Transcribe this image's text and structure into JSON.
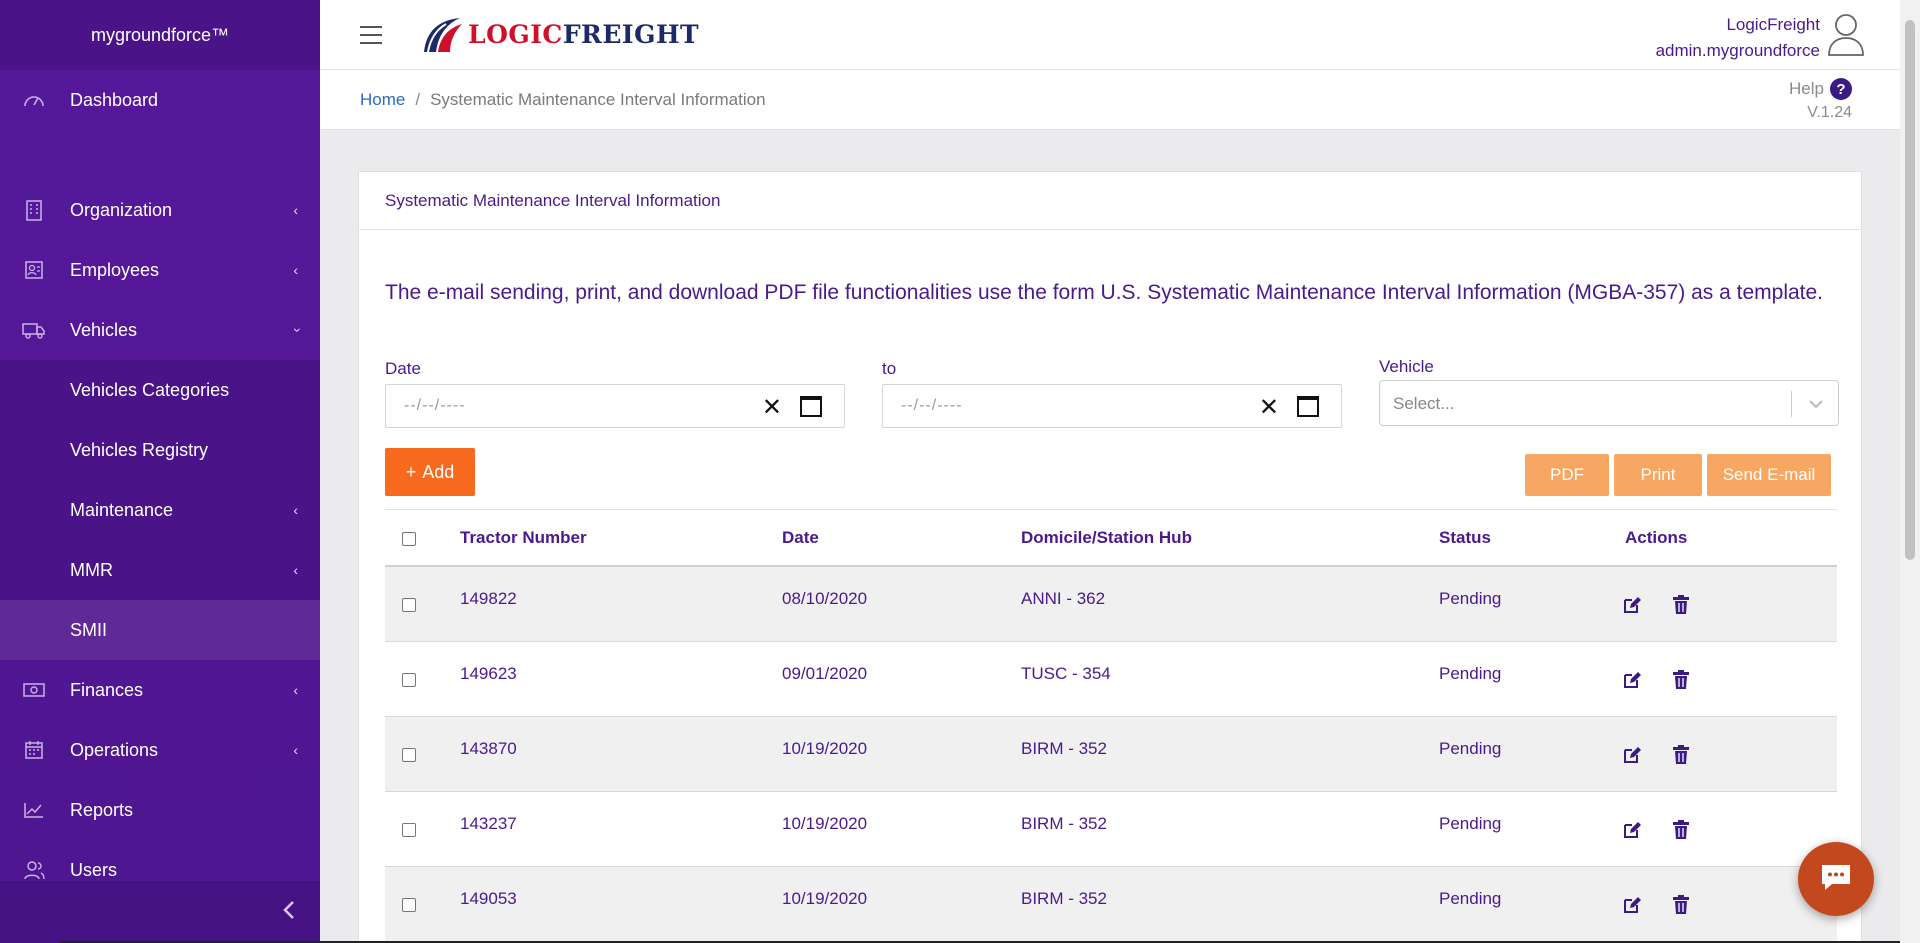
{
  "brand": "mygroundforce™",
  "sidebar": {
    "items": [
      {
        "label": "Dashboard"
      },
      {
        "label": "Organization"
      },
      {
        "label": "Employees"
      },
      {
        "label": "Vehicles"
      },
      {
        "label": "Vehicles Categories"
      },
      {
        "label": "Vehicles Registry"
      },
      {
        "label": "Maintenance"
      },
      {
        "label": "MMR"
      },
      {
        "label": "SMII"
      },
      {
        "label": "Finances"
      },
      {
        "label": "Operations"
      },
      {
        "label": "Reports"
      },
      {
        "label": "Users"
      }
    ]
  },
  "header": {
    "logo_part1": "LOGIC",
    "logo_part2": "FREIGHT",
    "company": "LogicFreight",
    "username": "admin.mygroundforce"
  },
  "breadcrumb": {
    "home": "Home",
    "separator": "/",
    "current": "Systematic Maintenance Interval Information"
  },
  "help_label": "Help",
  "help_icon": "?",
  "version": "V.1.24",
  "card": {
    "title": "Systematic Maintenance Interval Information",
    "notice": "The e-mail sending, print, and download PDF file functionalities use the form U.S. Systematic Maintenance Interval Information (MGBA-357) as a template."
  },
  "filters": {
    "date_label": "Date",
    "to_label": "to",
    "date_placeholder": "--/--/----",
    "vehicle_label": "Vehicle",
    "vehicle_placeholder": "Select..."
  },
  "buttons": {
    "add": "Add",
    "add_icon": "+",
    "pdf": "PDF",
    "print": "Print",
    "send_email": "Send E-mail"
  },
  "table": {
    "columns": [
      "Tractor Number",
      "Date",
      "Domicile/Station Hub",
      "Status",
      "Actions"
    ],
    "rows": [
      {
        "tractor": "149822",
        "date": "08/10/2020",
        "hub": "ANNI - 362",
        "status": "Pending"
      },
      {
        "tractor": "149623",
        "date": "09/01/2020",
        "hub": "TUSC - 354",
        "status": "Pending"
      },
      {
        "tractor": "143870",
        "date": "10/19/2020",
        "hub": "BIRM - 352",
        "status": "Pending"
      },
      {
        "tractor": "143237",
        "date": "10/19/2020",
        "hub": "BIRM - 352",
        "status": "Pending"
      },
      {
        "tractor": "149053",
        "date": "10/19/2020",
        "hub": "BIRM - 352",
        "status": "Pending"
      }
    ]
  },
  "colors": {
    "sidebar": "#56189c",
    "accent_text": "#4a1a8c",
    "orange": "#f86b1e",
    "orange_soft": "#f8a762",
    "chat": "#c4481e"
  },
  "icons": {
    "dashboard": "gauge-icon",
    "organization": "building-icon",
    "employees": "id-card-icon",
    "vehicles": "truck-icon",
    "finances": "money-icon",
    "operations": "calendar-icon",
    "reports": "chart-line-icon",
    "users": "users-icon",
    "edit": "edit-icon",
    "delete": "trash-icon",
    "chat": "chat-icon"
  }
}
